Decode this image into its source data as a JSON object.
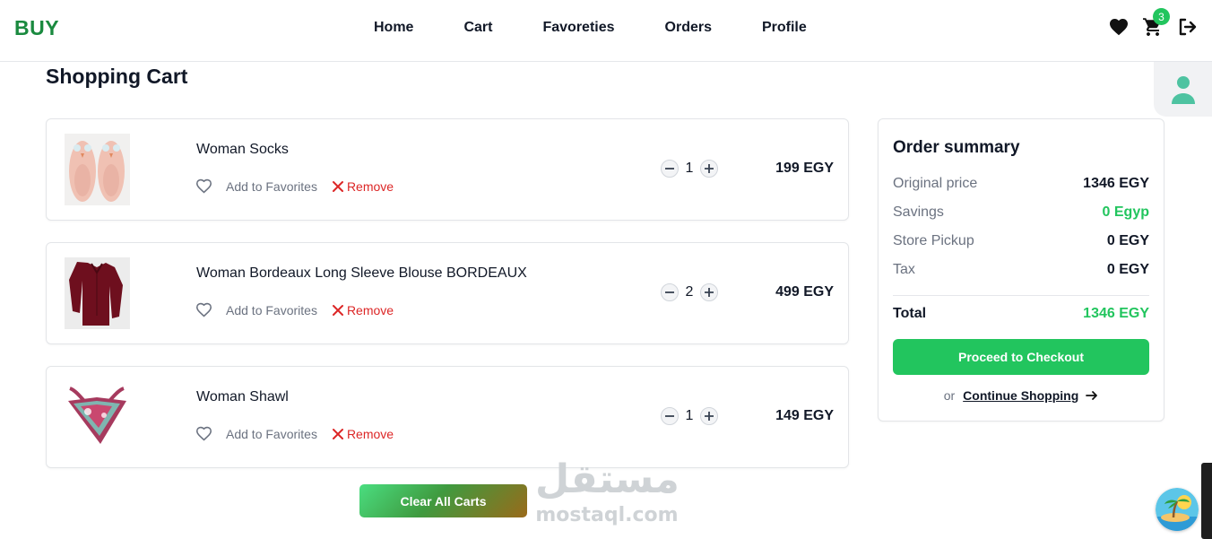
{
  "brand": "BUY",
  "nav": [
    "Home",
    "Cart",
    "Favoreties",
    "Orders",
    "Profile"
  ],
  "icons": {
    "favorites": "heart-icon",
    "cart": "cart-icon",
    "logout": "logout-icon",
    "profile": "user-icon"
  },
  "cart_badge": "3",
  "page_title": "Shopping Cart",
  "cart_items": [
    {
      "name": "Woman Socks",
      "qty": "1",
      "price": "199 EGY",
      "fav_label": "Add to Favorites",
      "remove_label": "Remove"
    },
    {
      "name": "Woman Bordeaux Long Sleeve Blouse BORDEAUX",
      "qty": "2",
      "price": "499 EGY",
      "fav_label": "Add to Favorites",
      "remove_label": "Remove"
    },
    {
      "name": "Woman Shawl",
      "qty": "1",
      "price": "149 EGY",
      "fav_label": "Add to Favorites",
      "remove_label": "Remove"
    }
  ],
  "clear_label": "Clear All Carts",
  "summary": {
    "title": "Order summary",
    "original_label": "Original price",
    "original_value": "1346 EGY",
    "savings_label": "Savings",
    "savings_value": "0 Egyp",
    "pickup_label": "Store Pickup",
    "pickup_value": "0 EGY",
    "tax_label": "Tax",
    "tax_value": "0 EGY",
    "total_label": "Total",
    "total_value": "1346 EGY",
    "checkout_label": "Proceed to Checkout",
    "or_label": "or",
    "continue_label": "Continue Shopping"
  },
  "watermark": {
    "arabic": "مستقل",
    "latin": "mostaql.com"
  },
  "colors": {
    "brand": "#1a8a3f",
    "accent": "#22c55e",
    "danger": "#dc2626",
    "muted": "#6b7280"
  }
}
